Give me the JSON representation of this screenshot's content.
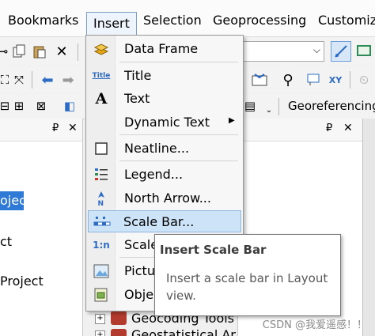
{
  "menubar": {
    "bookmarks": "Bookmarks",
    "insert": "Insert",
    "selection": "Selection",
    "geoprocessing": "Geoprocessing",
    "customize": "Customize"
  },
  "toolbar": {
    "georeferencing_label": "Georeferencing"
  },
  "left_panel": {
    "pin": "₽",
    "close": "✕",
    "items": [
      "oject",
      "ct",
      "Project"
    ]
  },
  "right_panel": {
    "pin": "₽",
    "close": "✕",
    "items": [
      "Geocoding Tools",
      "Geostatistical Analyst Tools"
    ]
  },
  "insert_menu": {
    "items": [
      {
        "label": "Data Frame",
        "icon": "data-frame-icon"
      },
      {
        "label": "Title",
        "icon": "title-icon"
      },
      {
        "label": "Text",
        "icon": "text-icon"
      },
      {
        "label": "Dynamic Text",
        "icon": "none"
      },
      {
        "label": "Neatline...",
        "icon": "neatline-icon"
      },
      {
        "label": "Legend...",
        "icon": "legend-icon"
      },
      {
        "label": "North Arrow...",
        "icon": "north-arrow-icon"
      },
      {
        "label": "Scale Bar...",
        "icon": "scale-bar-icon",
        "highlighted": true
      },
      {
        "label": "Scale",
        "icon": "scale-text-icon"
      },
      {
        "label": "Pictur",
        "icon": "picture-icon"
      },
      {
        "label": "Obje",
        "icon": "object-icon"
      }
    ],
    "icon_text": {
      "title": "Title",
      "text": "A",
      "north": "N",
      "scale_text": "1:n"
    }
  },
  "tooltip": {
    "title": "Insert Scale Bar",
    "body": "Insert a scale bar in Layout view."
  },
  "watermark": "CSDN @我爱遥感！！",
  "colors": {
    "highlight": "#cde3f7",
    "highlight_border": "#8fb4dc",
    "accent_blue": "#2e6cc4"
  }
}
